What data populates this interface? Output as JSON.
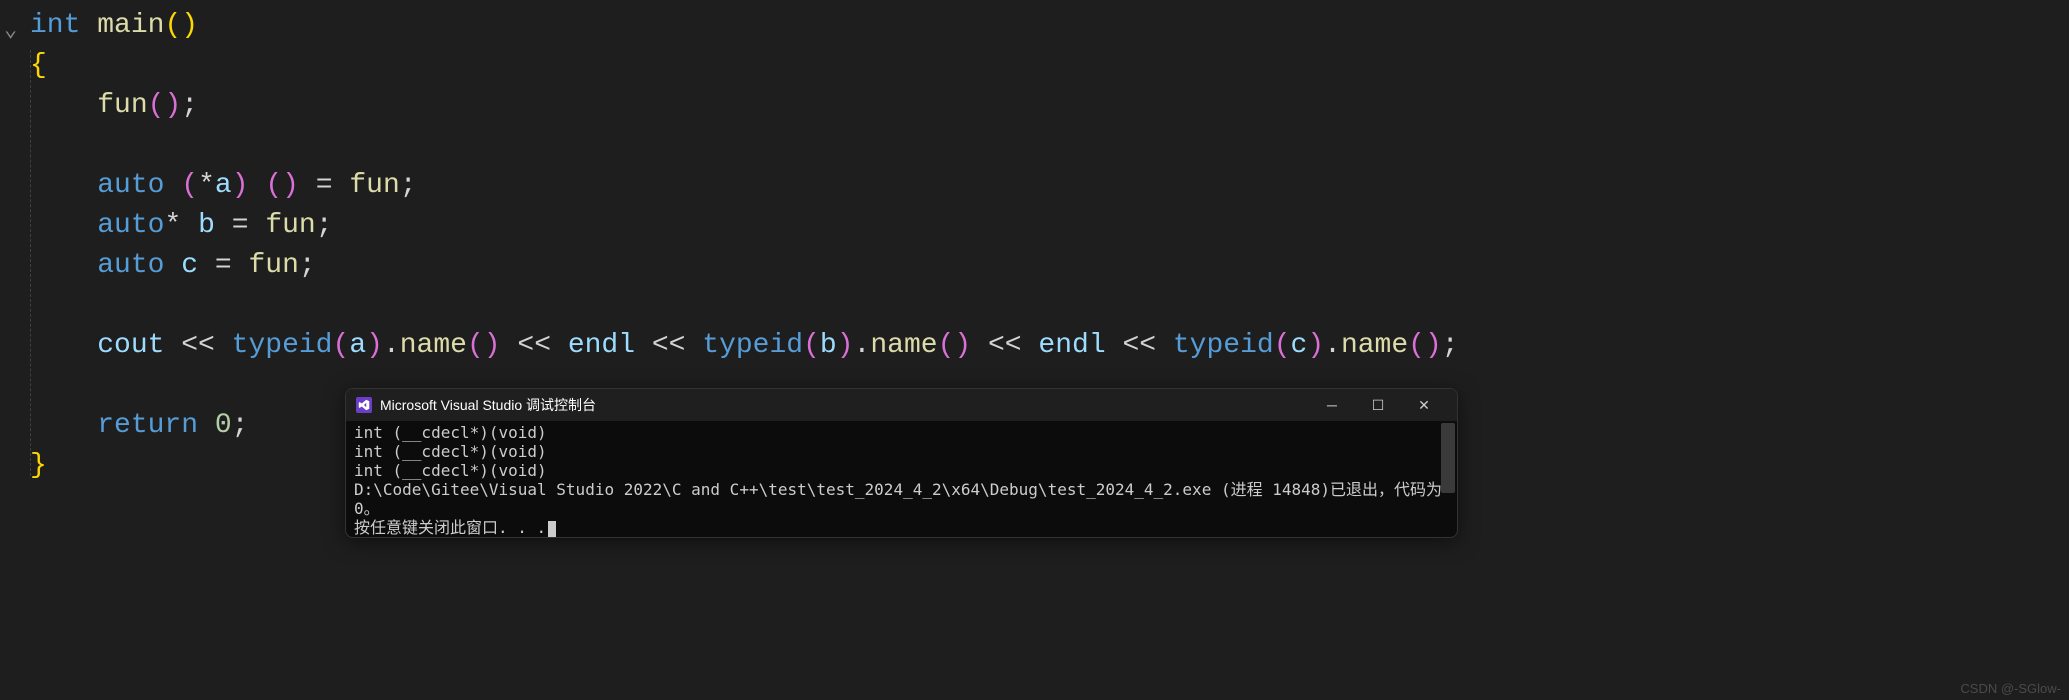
{
  "code": {
    "line1": {
      "kw": "int",
      "name": "main",
      "paren": "()"
    },
    "line2": "{",
    "line3": {
      "fn": "fun",
      "tail": "();"
    },
    "line5": {
      "kw": "auto",
      "star": "*",
      "var": "a",
      "assign": "=",
      "fn": "fun",
      "semi": ";"
    },
    "line6": {
      "kw": "auto",
      "star": "*",
      "var": "b",
      "assign": "=",
      "fn": "fun",
      "semi": ";"
    },
    "line7": {
      "kw": "auto",
      "var": "c",
      "assign": "=",
      "fn": "fun",
      "semi": ";"
    },
    "line9": {
      "cout": "cout",
      "op": "<<",
      "typeid": "typeid",
      "a": "a",
      "b": "b",
      "c": "c",
      "name": "name",
      "endl": "endl",
      "dot": ".",
      "semi": ";"
    },
    "line11": {
      "kw": "return",
      "num": "0",
      "semi": ";"
    },
    "line12": "}"
  },
  "console": {
    "title": "Microsoft Visual Studio 调试控制台",
    "output": [
      "int (__cdecl*)(void)",
      "int (__cdecl*)(void)",
      "int (__cdecl*)(void)",
      "D:\\Code\\Gitee\\Visual Studio 2022\\C and C++\\test\\test_2024_4_2\\x64\\Debug\\test_2024_4_2.exe (进程 14848)已退出，代码为 0。",
      "按任意键关闭此窗口. . ."
    ],
    "icon_label": "VS"
  },
  "credit": "CSDN @-SGlow-"
}
